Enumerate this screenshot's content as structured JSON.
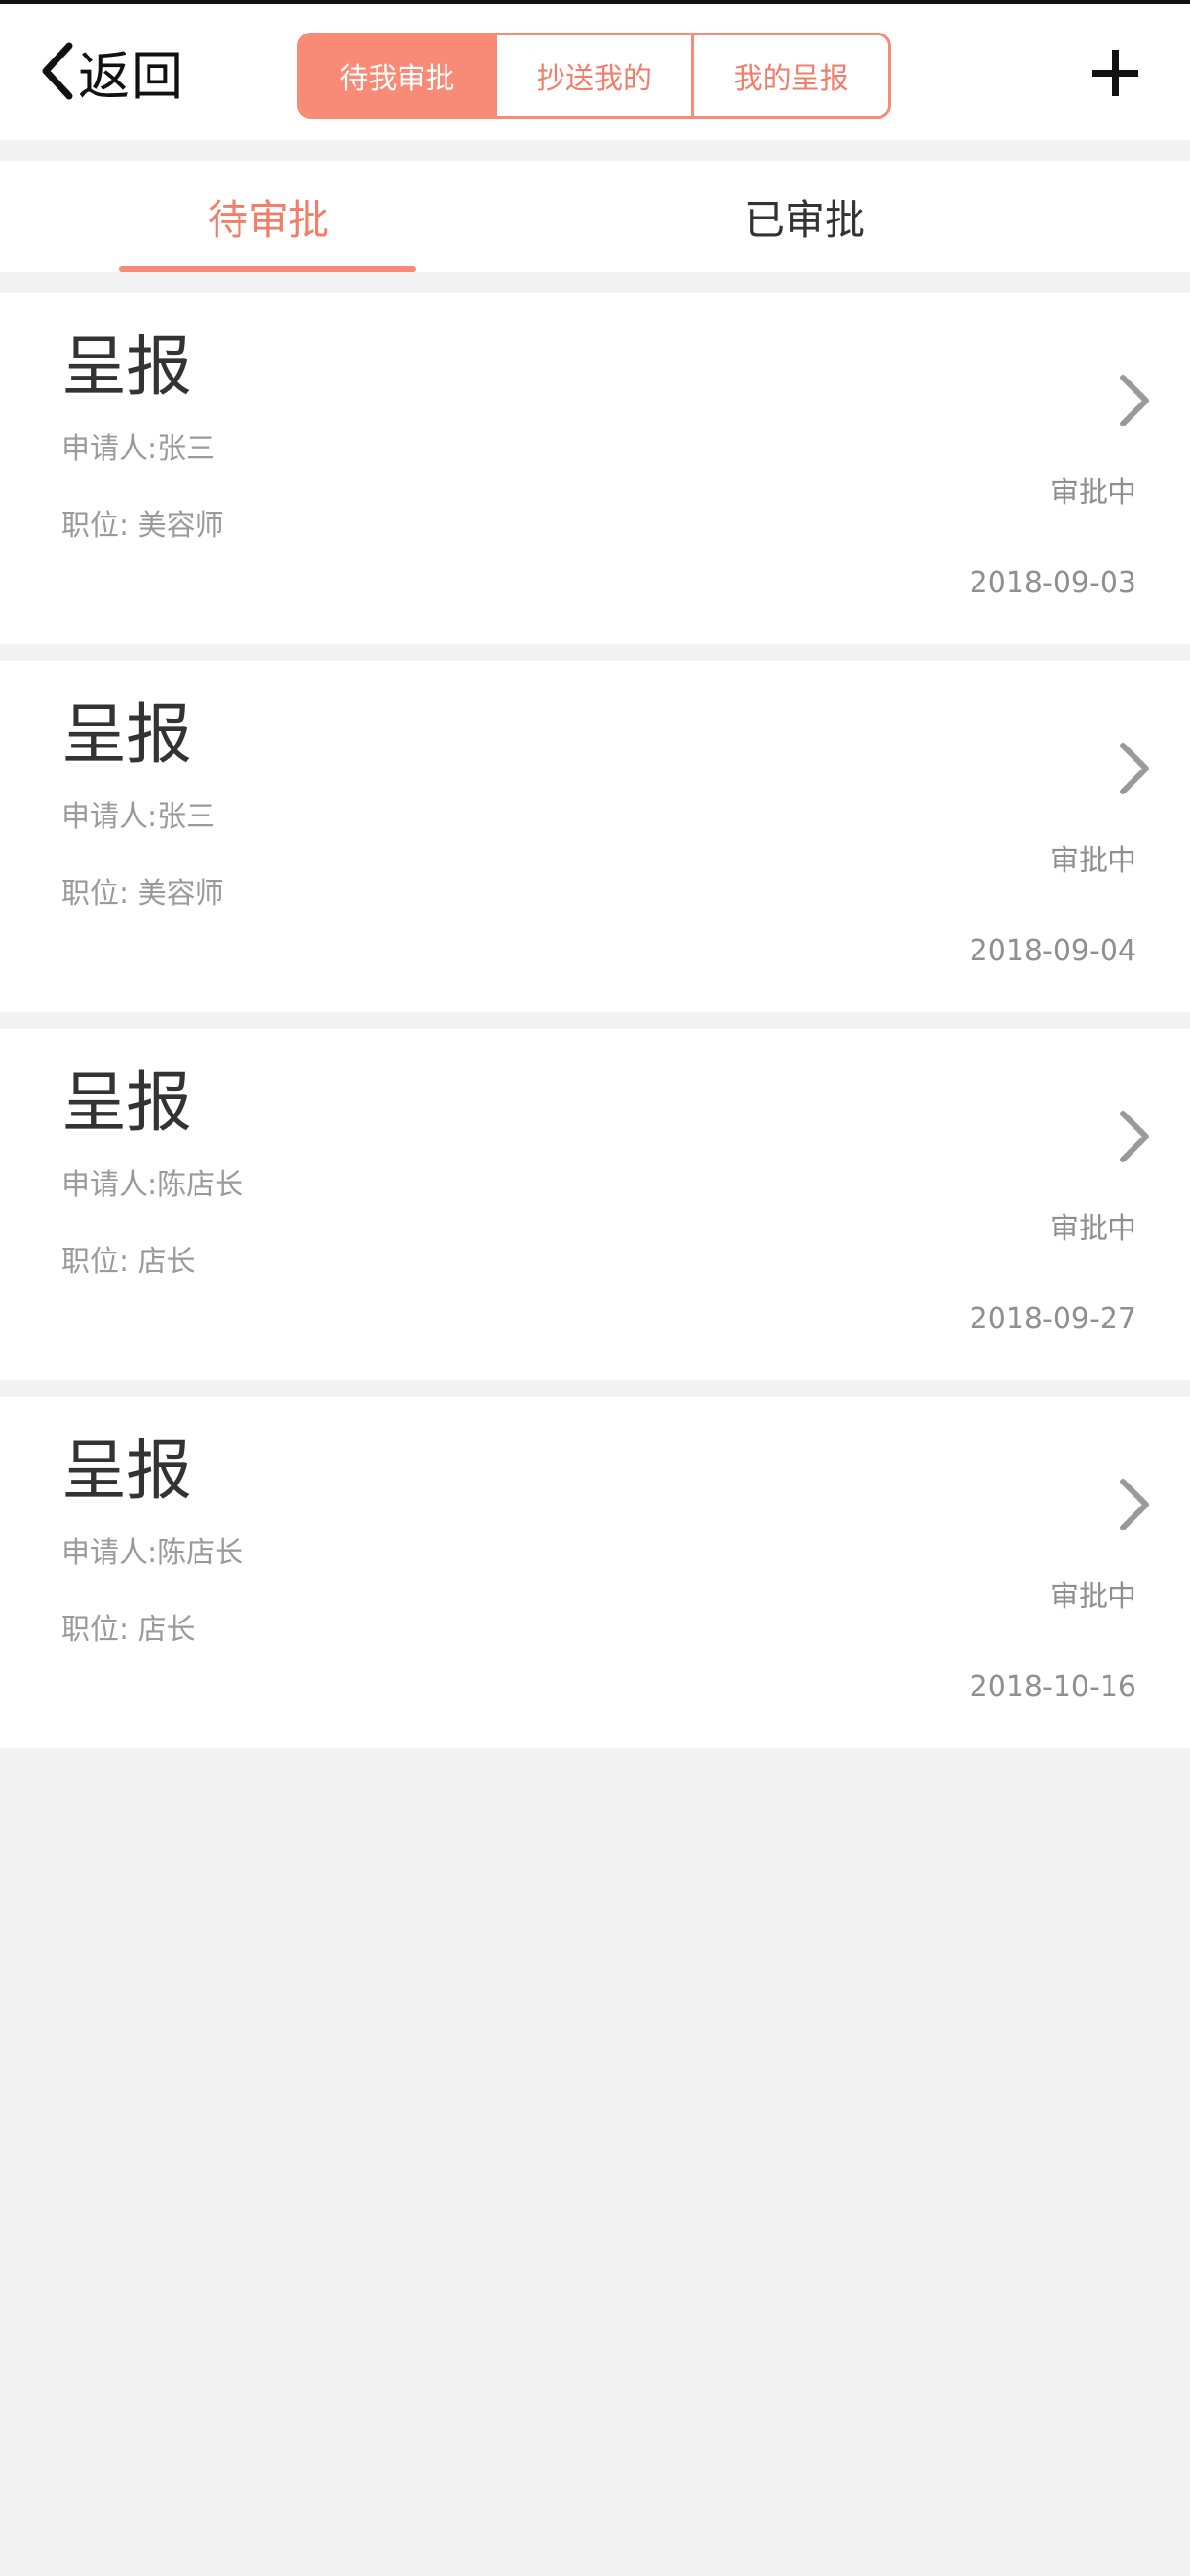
{
  "header": {
    "back_label": "返回",
    "segments": [
      {
        "label": "待我审批",
        "active": true
      },
      {
        "label": "抄送我的",
        "active": false
      },
      {
        "label": "我的呈报",
        "active": false
      }
    ],
    "add_icon": "plus-icon"
  },
  "tabs": {
    "items": [
      {
        "label": "待审批",
        "active": true
      },
      {
        "label": "已审批",
        "active": false
      }
    ]
  },
  "list": {
    "items": [
      {
        "title": "呈报",
        "applicant": "申请人:张三",
        "position": "职位: 美容师",
        "status": "审批中",
        "date": "2018-09-03"
      },
      {
        "title": "呈报",
        "applicant": "申请人:张三",
        "position": "职位: 美容师",
        "status": "审批中",
        "date": "2018-09-04"
      },
      {
        "title": "呈报",
        "applicant": "申请人:陈店长",
        "position": "职位: 店长",
        "status": "审批中",
        "date": "2018-09-27"
      },
      {
        "title": "呈报",
        "applicant": "申请人:陈店长",
        "position": "职位: 店长",
        "status": "审批中",
        "date": "2018-10-16"
      }
    ]
  },
  "colors": {
    "accent": "#f88a76",
    "accent_text": "#f07e69",
    "background": "#f2f2f2",
    "text_primary": "#333333",
    "text_secondary": "#9a9a9a"
  }
}
